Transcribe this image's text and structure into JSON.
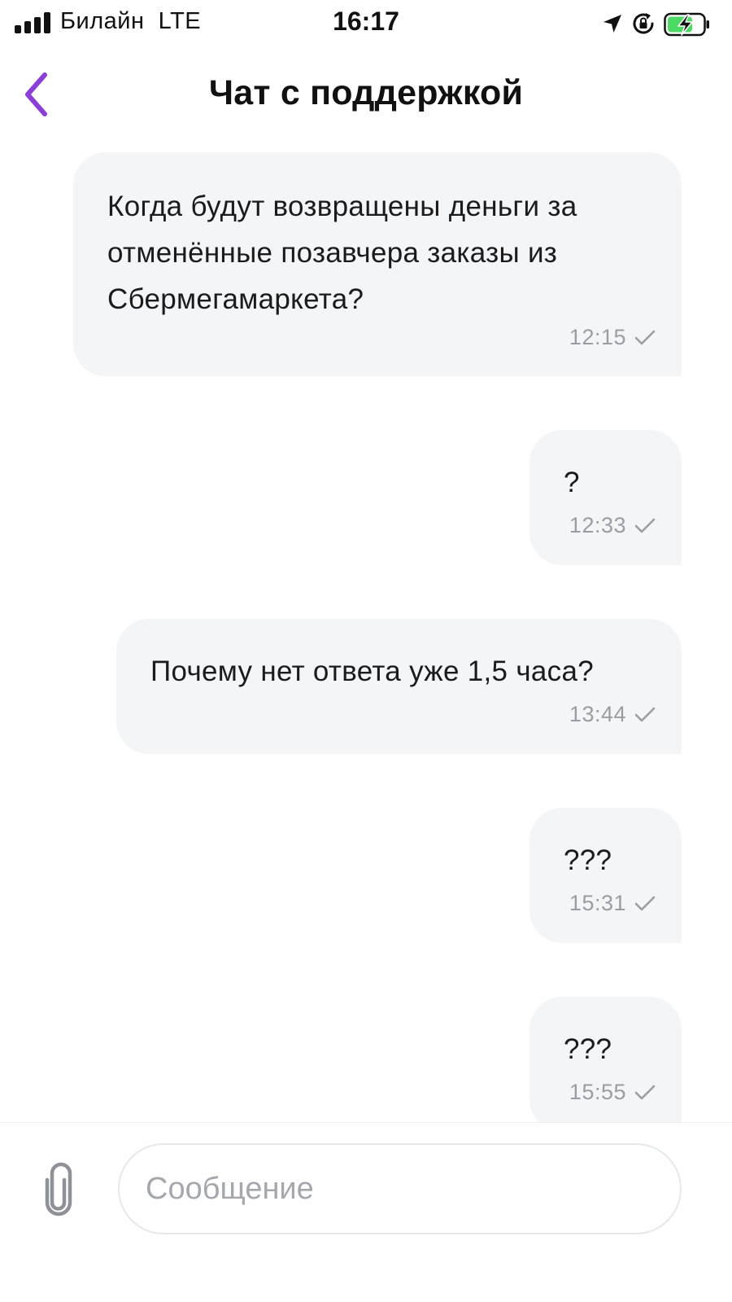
{
  "status_bar": {
    "carrier": "Билайн  LTE",
    "time": "16:17",
    "icons": [
      "signal-icon",
      "location-arrow-icon",
      "orientation-lock-icon",
      "battery-charging-icon"
    ]
  },
  "header": {
    "back_icon": "chevron-left-icon",
    "title": "Чат с поддержкой"
  },
  "colors": {
    "accent": "#8a3fd6",
    "bubble_bg": "#f3f5f7",
    "time_text": "#9a9ea4",
    "battery_fill": "#4cd964"
  },
  "messages": [
    {
      "lines": [
        "Когда будут возвращены деньги за",
        "отменённые позавчера заказы из",
        "Сбермегамаркета?"
      ],
      "time": "12:15",
      "status_icon": "checkmark-icon"
    },
    {
      "lines": [
        "?"
      ],
      "time": "12:33",
      "status_icon": "checkmark-icon"
    },
    {
      "lines": [
        "Почему нет ответа уже 1,5 часа?"
      ],
      "time": "13:44",
      "status_icon": "checkmark-icon"
    },
    {
      "lines": [
        "???"
      ],
      "time": "15:31",
      "status_icon": "checkmark-icon"
    },
    {
      "lines": [
        "???"
      ],
      "time": "15:55",
      "status_icon": "checkmark-icon"
    }
  ],
  "composer": {
    "attach_icon": "paperclip-icon",
    "placeholder": "Сообщение",
    "value": ""
  }
}
